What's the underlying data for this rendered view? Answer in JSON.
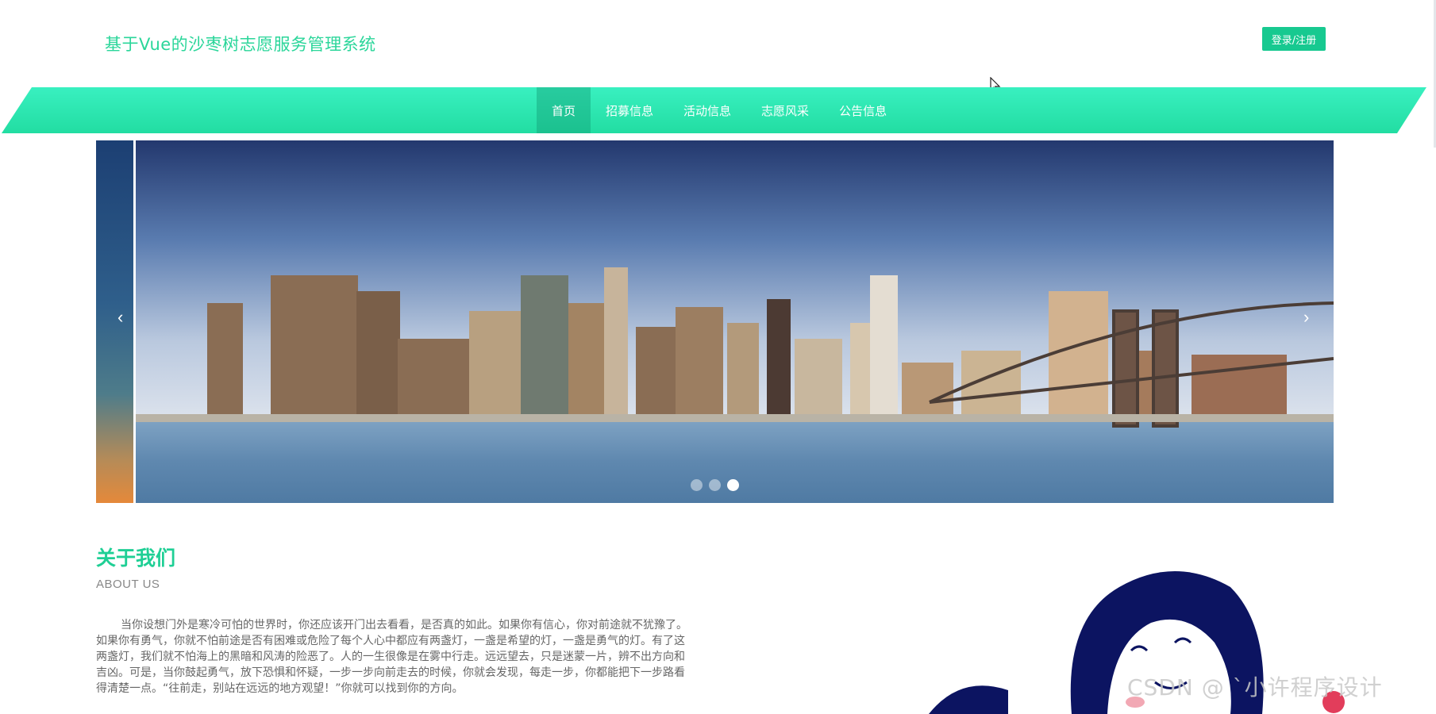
{
  "header": {
    "site_title": "基于Vue的沙枣树志愿服务管理系统",
    "login_label": "登录/注册"
  },
  "nav": {
    "items": [
      {
        "label": "首页",
        "active": true
      },
      {
        "label": "招募信息",
        "active": false
      },
      {
        "label": "活动信息",
        "active": false
      },
      {
        "label": "志愿风采",
        "active": false
      },
      {
        "label": "公告信息",
        "active": false
      }
    ]
  },
  "carousel": {
    "prev_arrow": "‹",
    "next_arrow": "›",
    "slide_count": 3,
    "active_slide": 3
  },
  "about": {
    "title": "关于我们",
    "subtitle": "ABOUT US",
    "text": "当你设想门外是寒冷可怕的世界时，你还应该开门出去看看，是否真的如此。如果你有信心，你对前途就不犹豫了。如果你有勇气，你就不怕前途是否有困难或危险了每个人心中都应有两盏灯，一盏是希望的灯，一盏是勇气的灯。有了这两盏灯，我们就不怕海上的黑暗和风涛的险恶了。人的一生很像是在雾中行走。远远望去，只是迷蒙一片，辨不出方向和吉凶。可是，当你鼓起勇气，放下恐惧和怀疑，一步一步向前走去的时候，你就会发现，每走一步，你都能把下一步路看得清楚一点。“往前走，别站在远远的地方观望！”你就可以找到你的方向。"
  },
  "watermark": "CSDN @ `小许程序设计",
  "colors": {
    "accent": "#2bd69a",
    "button": "#17c990",
    "nav_gradient_top": "#39f0c0",
    "nav_gradient_bottom": "#22dda2"
  }
}
